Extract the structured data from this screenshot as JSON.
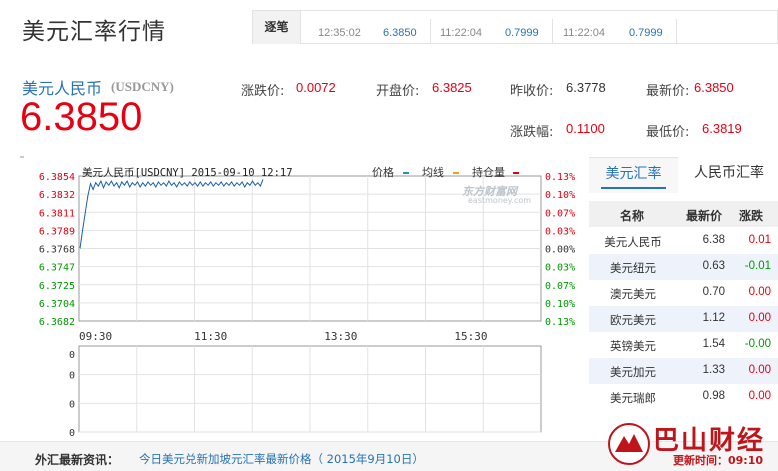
{
  "header": {
    "title": "美元汇率行情",
    "ticker_tab": "逐笔",
    "ticker": [
      {
        "time": "12:35:02",
        "value": "6.3850"
      },
      {
        "time": "11:22:04",
        "value": "0.7999"
      },
      {
        "time": "11:22:04",
        "value": "0.7999"
      }
    ]
  },
  "quote": {
    "name": "美元人民币",
    "code": "(USDCNY)",
    "price": "6.3850",
    "fields": {
      "change_label": "涨跌价:",
      "change": "0.0072",
      "open_label": "开盘价:",
      "open": "6.3825",
      "prev_close_label": "昨收价:",
      "prev_close": "6.3778",
      "last_label": "最新价:",
      "last": "6.3850",
      "change_pct_label": "涨跌幅:",
      "change_pct": "0.1100",
      "low_label": "最低价:",
      "low": "6.3819"
    }
  },
  "chart": {
    "title": "美元人民币[USDCNY] 2015-09-10 12:17",
    "legend": [
      {
        "label": "价格",
        "color": "#2a8fbd"
      },
      {
        "label": "均线",
        "color": "#f0a020"
      },
      {
        "label": "持仓量",
        "color": "#e60012"
      }
    ],
    "watermark": "东方财富网",
    "watermark_url": "eastmoney.com",
    "lower_ylabels": [
      "0",
      "0",
      "0",
      "0"
    ],
    "colors": {
      "up": "#e60012",
      "flat": "#333333",
      "down": "#009900",
      "line": "#1a5fa8"
    }
  },
  "chart_data": {
    "type": "line",
    "title": "美元人民币[USDCNY] 2015-09-10 12:17",
    "ylabels_price": [
      "6.3854",
      "6.3832",
      "6.3811",
      "6.3789",
      "6.3768",
      "6.3747",
      "6.3725",
      "6.3704",
      "6.3682"
    ],
    "ylabels_pct": [
      "0.13%",
      "0.10%",
      "0.07%",
      "0.03%",
      "0.00%",
      "0.03%",
      "0.07%",
      "0.10%",
      "0.13%"
    ],
    "xlabels": [
      "09:30",
      "11:30",
      "13:30",
      "15:30"
    ],
    "ylim": [
      6.3682,
      6.3854
    ],
    "series": [
      {
        "values": [
          6.3768,
          6.379,
          6.381,
          6.383,
          6.3845,
          6.3838,
          6.3846,
          6.3842,
          6.3848,
          6.384,
          6.3847,
          6.3843,
          6.3848,
          6.3842,
          6.3846,
          6.384,
          6.3847,
          6.3843,
          6.3848,
          6.3841,
          6.3846,
          6.3843,
          6.3847,
          6.3841,
          6.3846,
          6.3842,
          6.3847,
          6.3843,
          6.3846,
          6.3841,
          6.3847,
          6.3843,
          6.3846,
          6.3842,
          6.3848,
          6.3843,
          6.3846,
          6.3841,
          6.3847,
          6.3843,
          6.3846,
          6.3842,
          6.3847,
          6.3843,
          6.3846,
          6.3842,
          6.3847,
          6.3842,
          6.3846,
          6.3843,
          6.3847,
          6.3842,
          6.3846,
          6.3843,
          6.3847,
          6.3842,
          6.3846,
          6.3843,
          6.3847,
          6.3842,
          6.3846,
          6.3843,
          6.3847,
          6.3841,
          6.3846,
          6.3843,
          6.3848,
          6.3843,
          6.3846,
          6.3842,
          6.385
        ]
      }
    ]
  },
  "rates": {
    "tabs": [
      "美元汇率",
      "人民币汇率"
    ],
    "headers": [
      "名称",
      "最新价",
      "涨跌"
    ],
    "rows": [
      {
        "name": "美元人民币",
        "price": "6.38",
        "change": "0.01",
        "dir": "up"
      },
      {
        "name": "美元纽元",
        "price": "0.63",
        "change": "-0.01",
        "dir": "down"
      },
      {
        "name": "澳元美元",
        "price": "0.70",
        "change": "0.00",
        "dir": "up"
      },
      {
        "name": "欧元美元",
        "price": "1.12",
        "change": "0.00",
        "dir": "up"
      },
      {
        "name": "英镑美元",
        "price": "1.54",
        "change": "-0.00",
        "dir": "down"
      },
      {
        "name": "美元加元",
        "price": "1.33",
        "change": "0.00",
        "dir": "up"
      },
      {
        "name": "美元瑞郎",
        "price": "0.98",
        "change": "0.00",
        "dir": "up"
      }
    ]
  },
  "news": {
    "label": "外汇最新资讯：",
    "headline": "今日美元兑新加坡元汇率最新价格（ 2015年9月10日）",
    "brand": "巴山财经",
    "brand_sub": "更新时间：09:10"
  }
}
